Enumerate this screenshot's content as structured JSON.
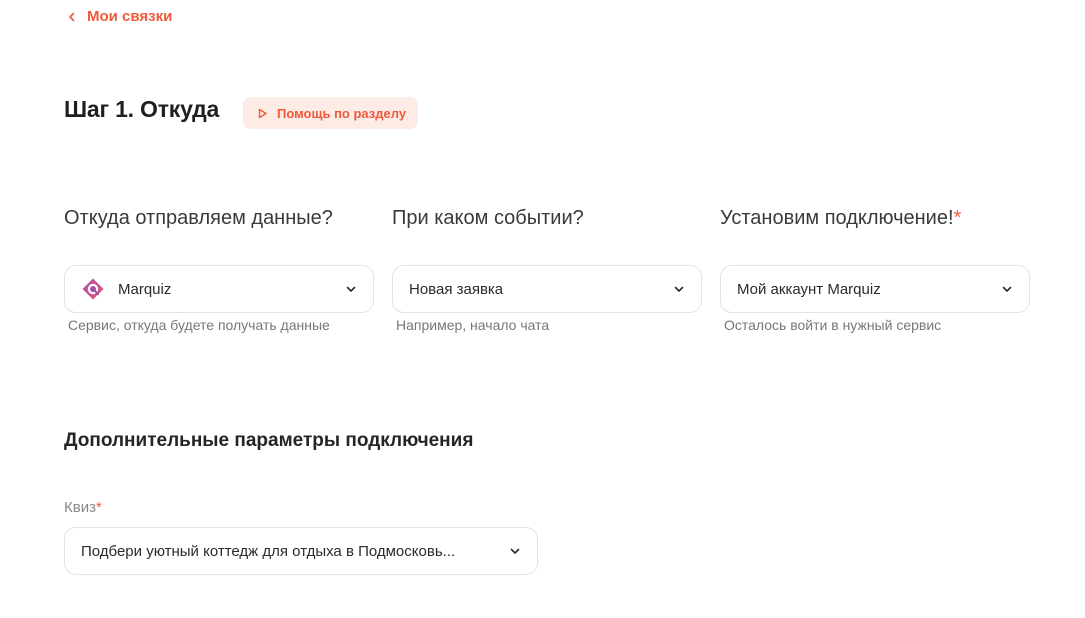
{
  "nav": {
    "back_label": "Мои связки"
  },
  "header": {
    "step_title": "Шаг 1. Откуда",
    "help_label": "Помощь по разделу"
  },
  "columns": [
    {
      "question": "Откуда отправляем данные?",
      "value": "Marquiz",
      "hint": "Сервис, откуда будете получать данные",
      "icon": "marquiz-logo-icon"
    },
    {
      "question": "При каком событии?",
      "value": "Новая заявка",
      "hint": "Например, начало чата"
    },
    {
      "question": "Установим подключение!",
      "required_mark": "*",
      "value": "Мой аккаунт Marquiz",
      "hint": "Осталось войти в нужный сервис"
    }
  ],
  "extra": {
    "section_title": "Дополнительные параметры подключения",
    "quiz_label": "Квиз",
    "quiz_required_mark": "*",
    "quiz_value": "Подбери уютный коттедж для отдыха в Подмосковь..."
  },
  "colors": {
    "accent": "#f05a3b",
    "accent_bg": "#fdebe6",
    "border": "#e3e3e3",
    "hint": "#777777"
  }
}
